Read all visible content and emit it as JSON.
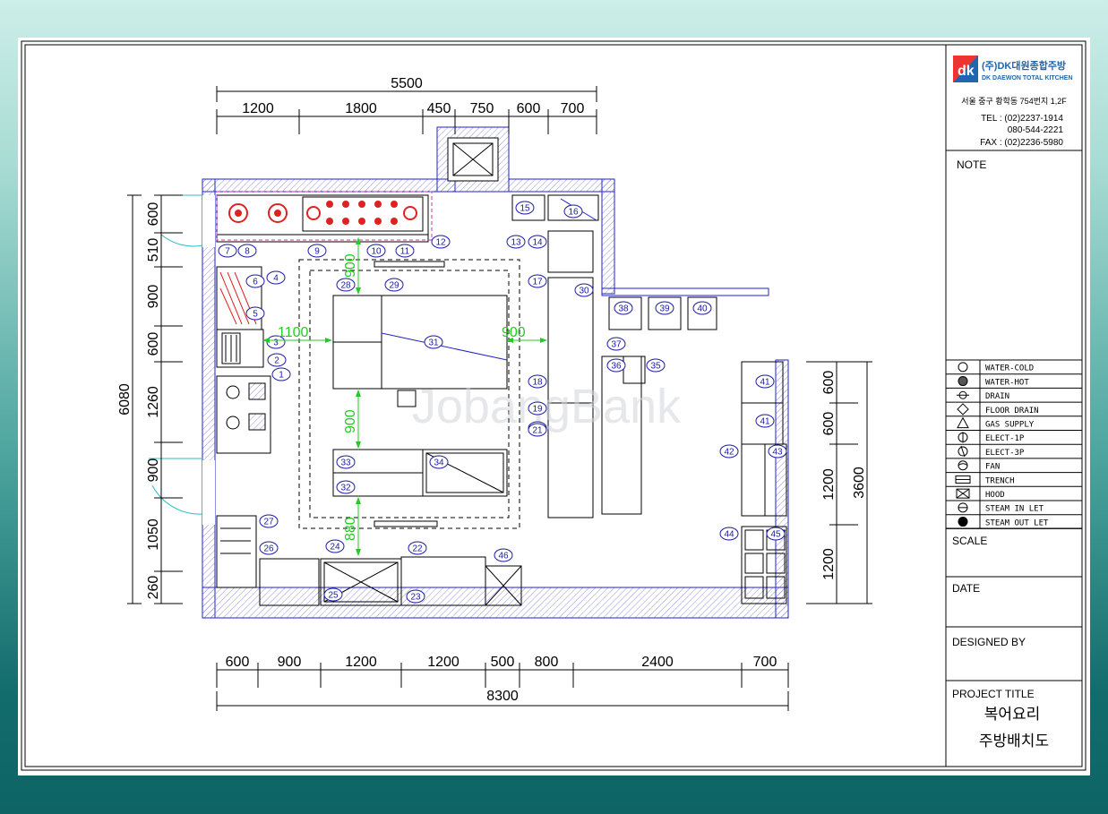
{
  "company": {
    "logo_mark": "dk",
    "name_ko": "(주)DK대원종합주방",
    "name_en": "DK DAEWON TOTAL KITCHEN",
    "address": "서울 중구 황학동 754번지 1,2F",
    "tel_1": "TEL : (02)2237-1914",
    "tel_2": "080-544-2221",
    "fax": "FAX : (02)2236-5980"
  },
  "title_block": {
    "note_label": "NOTE",
    "scale_label": "SCALE",
    "date_label": "DATE",
    "designed_by_label": "DESIGNED BY",
    "project_title_label": "PROJECT TITLE",
    "project_title_1": "복어요리",
    "project_title_2": "주방배치도"
  },
  "legend": [
    {
      "icon": "water-cold-icon",
      "label": "WATER-COLD"
    },
    {
      "icon": "water-hot-icon",
      "label": "WATER-HOT"
    },
    {
      "icon": "drain-icon",
      "label": "DRAIN"
    },
    {
      "icon": "floor-drain-icon",
      "label": "FLOOR DRAIN"
    },
    {
      "icon": "gas-supply-icon",
      "label": "GAS SUPPLY"
    },
    {
      "icon": "elect-1p-icon",
      "label": "ELECT-1P"
    },
    {
      "icon": "elect-3p-icon",
      "label": "ELECT-3P"
    },
    {
      "icon": "fan-icon",
      "label": "FAN"
    },
    {
      "icon": "trench-icon",
      "label": "TRENCH"
    },
    {
      "icon": "hood-icon",
      "label": "HOOD"
    },
    {
      "icon": "steam-inlet-icon",
      "label": "STEAM IN LET"
    },
    {
      "icon": "steam-outlet-icon",
      "label": "STEAM OUT LET"
    }
  ],
  "dimensions": {
    "top_total": "5500",
    "top_segments": [
      "1200",
      "1800",
      "450",
      "750",
      "600",
      "700"
    ],
    "bottom_total": "8300",
    "bottom_segments": [
      "600",
      "900",
      "1200",
      "1200",
      "500",
      "800",
      "2400",
      "700"
    ],
    "left_total": "6080",
    "left_segments": [
      "600",
      "510",
      "900",
      "600",
      "1260",
      "900",
      "1050",
      "260"
    ],
    "right_total": "3600",
    "right_segments": [
      "600",
      "600",
      "1200",
      "1200"
    ],
    "inner": [
      "900",
      "1100",
      "900",
      "900",
      "880"
    ]
  },
  "equipment_numbers": [
    "1",
    "2",
    "3",
    "4",
    "5",
    "6",
    "7",
    "8",
    "9",
    "10",
    "11",
    "12",
    "13",
    "14",
    "15",
    "16",
    "17",
    "18",
    "19",
    "20",
    "21",
    "22",
    "23",
    "24",
    "25",
    "26",
    "27",
    "28",
    "29",
    "30",
    "31",
    "32",
    "33",
    "34",
    "35",
    "36",
    "37",
    "38",
    "39",
    "40",
    "41",
    "41",
    "42",
    "43",
    "44",
    "45",
    "46"
  ],
  "watermark": "JobangBank",
  "colors": {
    "wall": "#2222cc",
    "dimension_green": "#22cc22",
    "burner": "#dd2222",
    "hood_magenta": "#cc33aa"
  }
}
